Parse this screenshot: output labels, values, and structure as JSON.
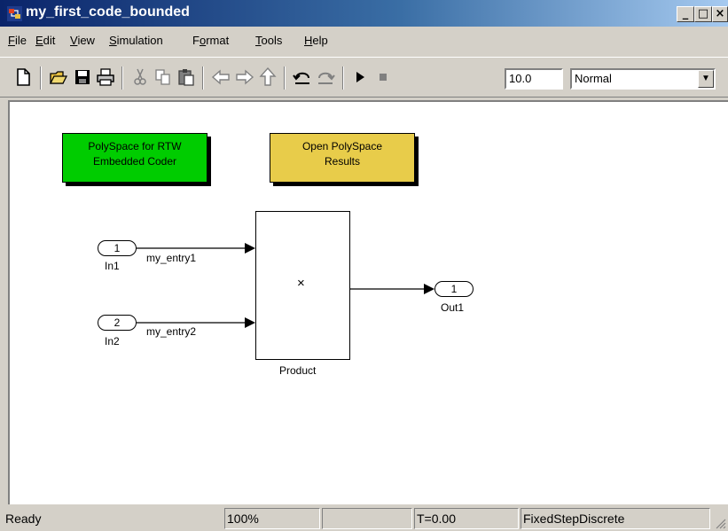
{
  "window": {
    "title": "my_first_code_bounded"
  },
  "menu": [
    {
      "label": "File",
      "u": "F",
      "rest": "ile"
    },
    {
      "label": "Edit",
      "u": "E",
      "rest": "dit"
    },
    {
      "label": "View",
      "u": "V",
      "rest": "iew"
    },
    {
      "label": "Simulation",
      "u": "S",
      "rest": "imulation"
    },
    {
      "label": "Format",
      "pre": "F",
      "u": "o",
      "rest": "rmat"
    },
    {
      "label": "Tools",
      "u": "T",
      "rest": "ools"
    },
    {
      "label": "Help",
      "u": "H",
      "rest": "elp"
    }
  ],
  "toolbar": {
    "icons": [
      "new-file-icon",
      "open-folder-icon",
      "save-icon",
      "print-icon",
      "cut-icon",
      "copy-icon",
      "paste-icon",
      "back-arrow-icon",
      "forward-arrow-icon",
      "up-arrow-icon",
      "undo-icon",
      "redo-icon",
      "start-simulation-icon",
      "stop-simulation-icon"
    ],
    "stop_time": "10.0",
    "sim_mode": "Normal"
  },
  "diagram": {
    "btn_polyspace_line1": "PolySpace for RTW",
    "btn_polyspace_line2": "Embedded Coder",
    "btn_open_line1": "Open PolySpace",
    "btn_open_line2": "Results",
    "in1_number": "1",
    "in1_name": "In1",
    "in1_signal": "my_entry1",
    "in2_number": "2",
    "in2_name": "In2",
    "in2_signal": "my_entry2",
    "product_symbol": "×",
    "product_name": "Product",
    "out1_number": "1",
    "out1_name": "Out1",
    "colors": {
      "polyspace_btn": "#00cc00",
      "open_btn": "#e8cc4a"
    }
  },
  "status": {
    "state": "Ready",
    "zoom": "100%",
    "empty": "",
    "time": "T=0.00",
    "solver": "FixedStepDiscrete"
  }
}
